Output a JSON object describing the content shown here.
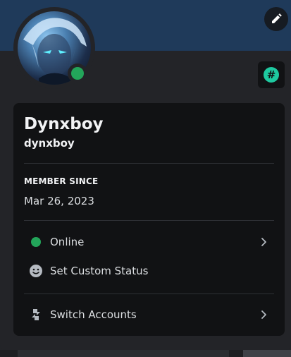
{
  "profile": {
    "display_name": "Dynxboy",
    "username": "dynxboy",
    "status": "online",
    "badge_symbol": "#"
  },
  "member_since": {
    "title": "MEMBER SINCE",
    "date": "Mar 26, 2023"
  },
  "menu": {
    "online_label": "Online",
    "custom_status_label": "Set Custom Status",
    "switch_accounts_label": "Switch Accounts"
  },
  "icons": {
    "edit": "pencil-icon",
    "status": "online-status-icon",
    "custom_status": "smiley-icon",
    "switch_accounts": "switch-accounts-icon",
    "chevron": "chevron-right-icon"
  },
  "colors": {
    "online": "#23a55a",
    "badge": "#1ec9a0",
    "banner": "#1f3a5a",
    "card": "#111214",
    "background": "#232428"
  }
}
